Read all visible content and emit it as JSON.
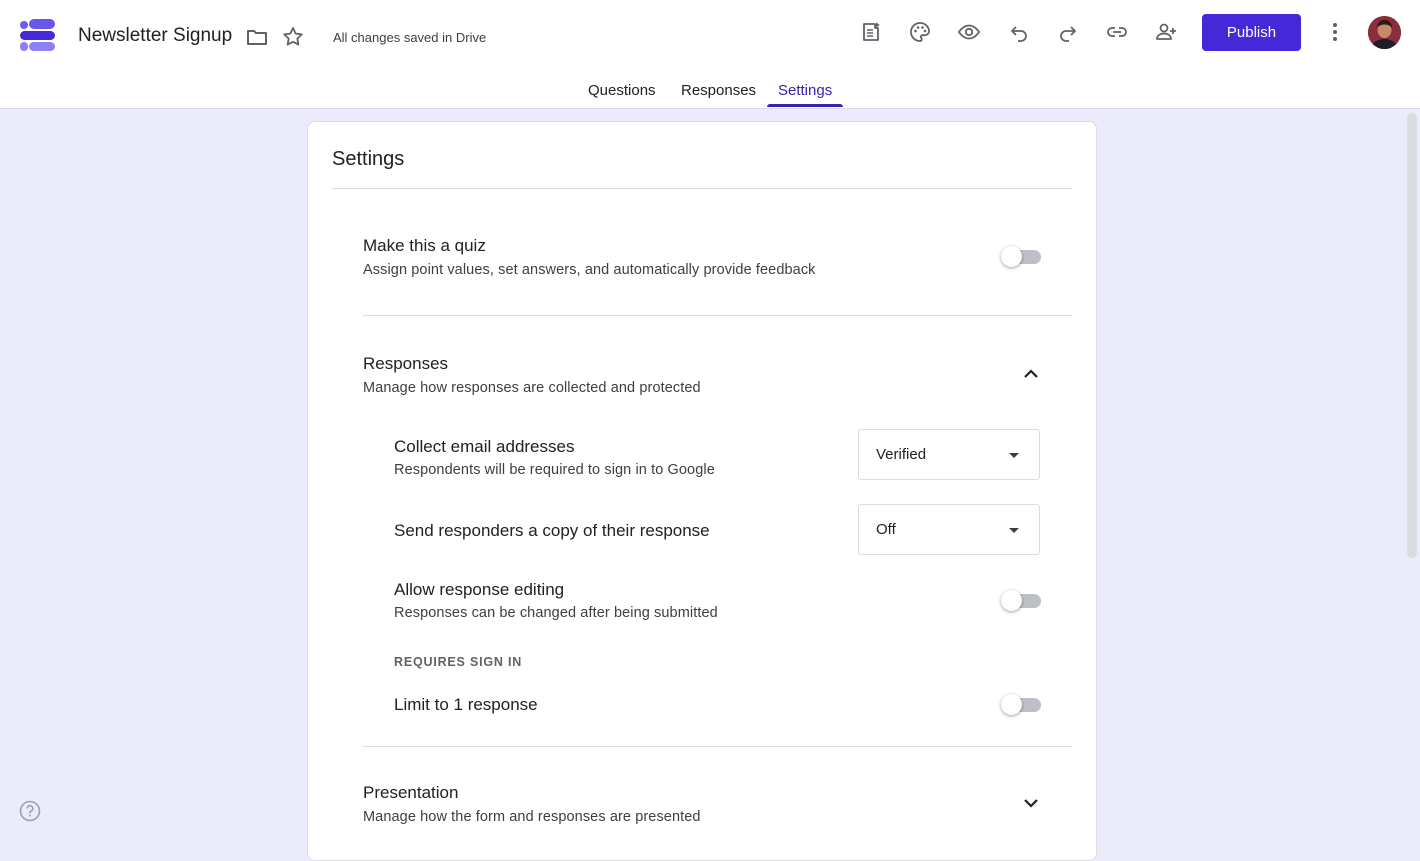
{
  "app": {
    "title": "Newsletter Signup",
    "save_status": "All changes saved in Drive",
    "publish_label": "Publish",
    "accent_color": "#4528d8"
  },
  "header_icons": [
    "folder-icon",
    "star-icon",
    "customize-icon",
    "palette-icon",
    "preview-icon",
    "undo-icon",
    "redo-icon",
    "link-icon",
    "add-collaborator-icon",
    "more-icon"
  ],
  "tabs": [
    {
      "label": "Questions",
      "active": false
    },
    {
      "label": "Responses",
      "active": false
    },
    {
      "label": "Settings",
      "active": true
    }
  ],
  "settings": {
    "title": "Settings",
    "quiz": {
      "title": "Make this a quiz",
      "subtitle": "Assign point values, set answers, and automatically provide feedback",
      "enabled": false
    },
    "responses": {
      "title": "Responses",
      "subtitle": "Manage how responses are collected and protected",
      "expanded": true,
      "collect_email": {
        "title": "Collect email addresses",
        "subtitle": "Respondents will be required to sign in to Google",
        "value": "Verified"
      },
      "send_copy": {
        "title": "Send responders a copy of their response",
        "value": "Off"
      },
      "allow_editing": {
        "title": "Allow response editing",
        "subtitle": "Responses can be changed after being submitted",
        "enabled": false
      },
      "requires_sign_in_label": "REQUIRES SIGN IN",
      "limit_one": {
        "title": "Limit to 1 response",
        "enabled": false
      }
    },
    "presentation": {
      "title": "Presentation",
      "subtitle": "Manage how the form and responses are presented",
      "expanded": false
    }
  }
}
